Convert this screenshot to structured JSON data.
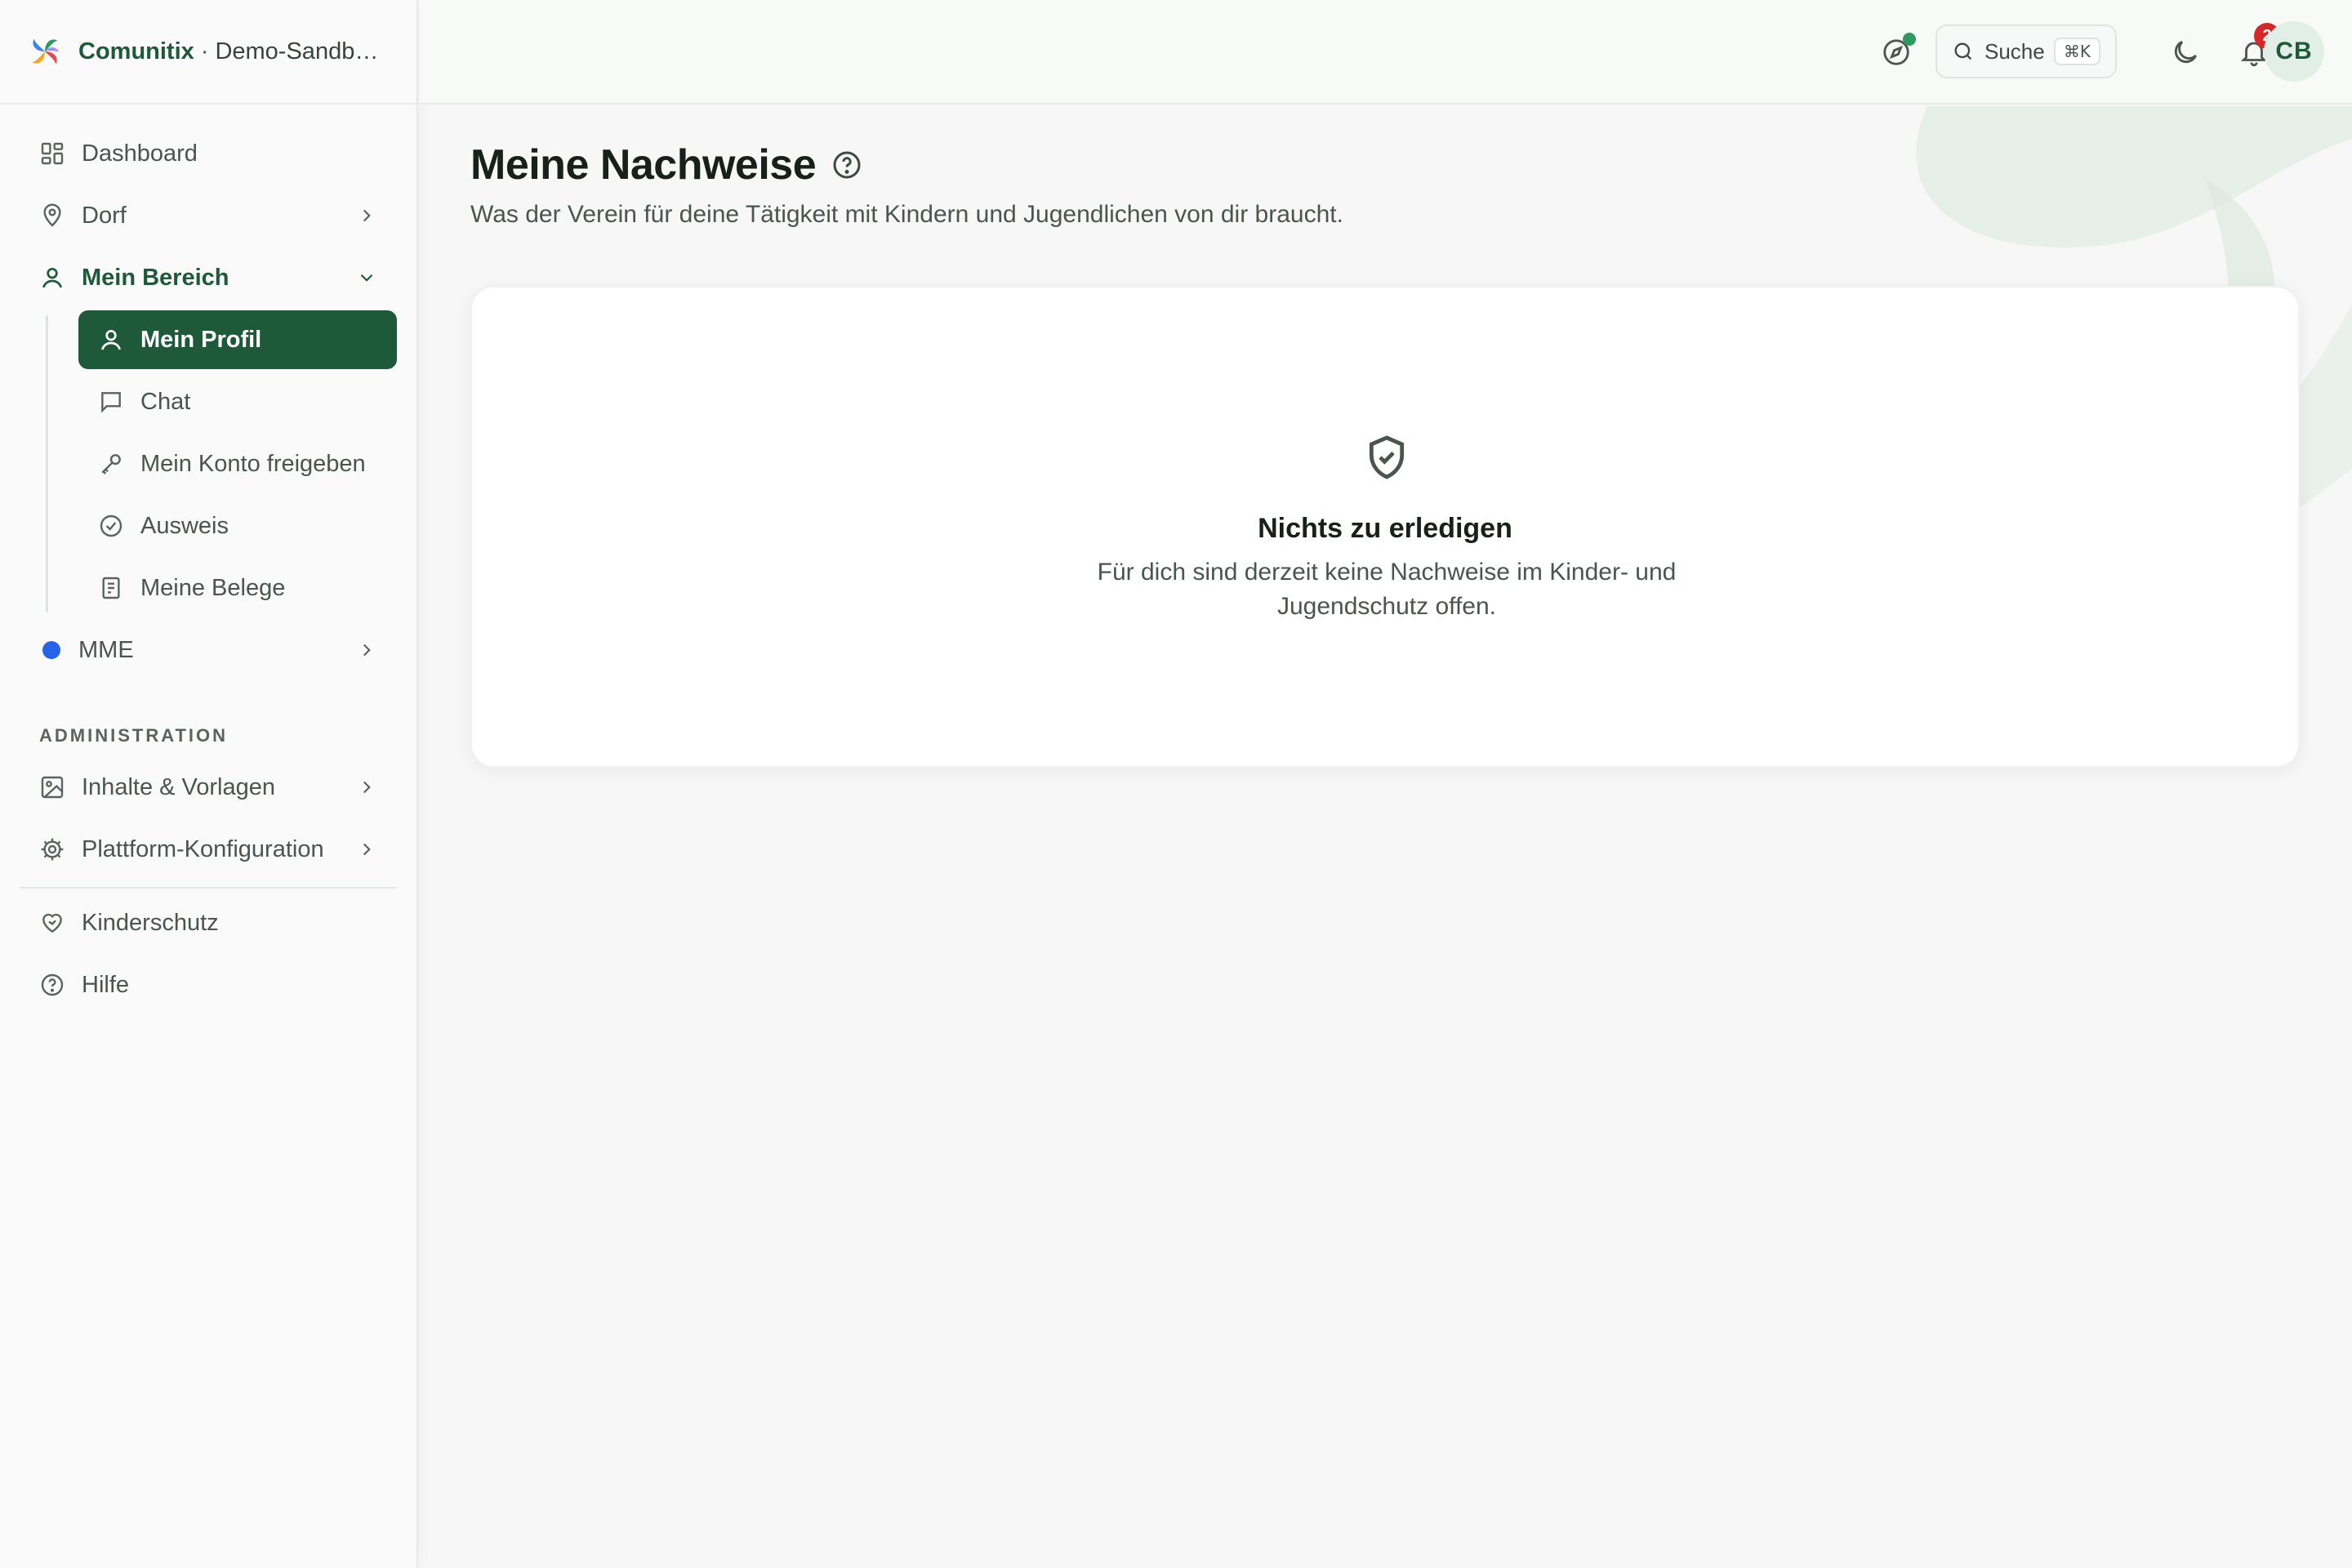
{
  "brand": {
    "name": "Comunitix",
    "separator": "·",
    "tenant": "Demo-Sandb…"
  },
  "sidebar": {
    "items": [
      {
        "label": "Dashboard",
        "icon": "dashboard-icon"
      },
      {
        "label": "Dorf",
        "icon": "map-pin-icon"
      },
      {
        "label": "Mein Bereich",
        "icon": "user-icon",
        "expanded": true
      }
    ],
    "mein_bereich": [
      {
        "label": "Mein Profil",
        "icon": "user-icon",
        "active": true
      },
      {
        "label": "Chat",
        "icon": "chat-icon"
      },
      {
        "label": "Mein Konto freigeben",
        "icon": "key-icon"
      },
      {
        "label": "Ausweis",
        "icon": "badge-check-icon"
      },
      {
        "label": "Meine Belege",
        "icon": "receipt-icon"
      }
    ],
    "mme": {
      "label": "MME",
      "dot_color": "#2563eb"
    },
    "admin_section": "ADMINISTRATION",
    "admin": [
      {
        "label": "Inhalte & Vorlagen",
        "icon": "image-icon"
      },
      {
        "label": "Plattform-Konfiguration",
        "icon": "gear-icon"
      }
    ],
    "footer": [
      {
        "label": "Kinderschutz",
        "icon": "heart-handshake-icon"
      },
      {
        "label": "Hilfe",
        "icon": "help-circle-icon"
      }
    ]
  },
  "topbar": {
    "search_label": "Suche",
    "search_shortcut": "⌘K",
    "notification_count": "2",
    "avatar_initials": "CB"
  },
  "main": {
    "title": "Meine Nachweise",
    "subtitle": "Was der Verein für deine Tätigkeit mit Kindern und Jugendlichen von dir braucht.",
    "empty_title": "Nichts zu erledigen",
    "empty_text": "Für dich sind derzeit keine Nachweise im Kinder- und Jugendschutz offen."
  },
  "colors": {
    "brand": "#1e5a3a",
    "active_bg": "#1e5a3a",
    "badge": "#d62828",
    "status_dot": "#2f9a5f"
  }
}
